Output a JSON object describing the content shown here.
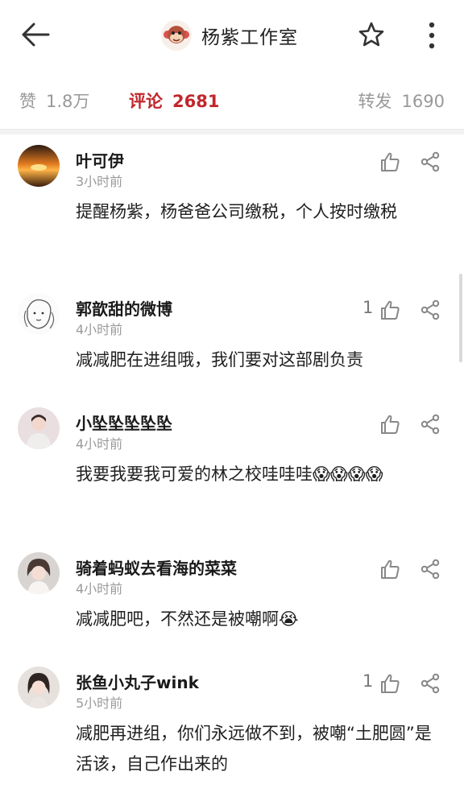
{
  "header": {
    "title": "杨紫工作室",
    "back_icon": "back-arrow-icon",
    "star_icon": "star-icon",
    "more_icon": "more-vertical-icon"
  },
  "stats": {
    "likes_label": "赞",
    "likes_value": "1.8万",
    "comments_label": "评论",
    "comments_value": "2681",
    "reposts_label": "转发",
    "reposts_value": "1690",
    "active_color": "#c1272d"
  },
  "comments": [
    {
      "name": "叶可伊",
      "time": "3小时前",
      "text": "提醒杨紫，杨爸爸公司缴税，个人按时缴税",
      "likes": ""
    },
    {
      "name": "郭歆甜的微博",
      "time": "4小时前",
      "text": "减减肥在进组哦，我们要对这部剧负责",
      "likes": "1"
    },
    {
      "name": "小坠坠坠坠坠",
      "time": "4小时前",
      "text": "我要我要我可爱的林之校哇哇哇",
      "emoji": "😱😱😱😱",
      "likes": ""
    },
    {
      "name": "骑着蚂蚁去看海的菜菜",
      "time": "4小时前",
      "text": "减减肥吧，不然还是被嘲啊",
      "emoji": "😭",
      "likes": ""
    },
    {
      "name": "张鱼小丸子wink",
      "time": "5小时前",
      "text": "减肥再进组，你们永远做不到，被嘲“土肥圆”是活该，自己作出来的",
      "likes": "1"
    }
  ]
}
